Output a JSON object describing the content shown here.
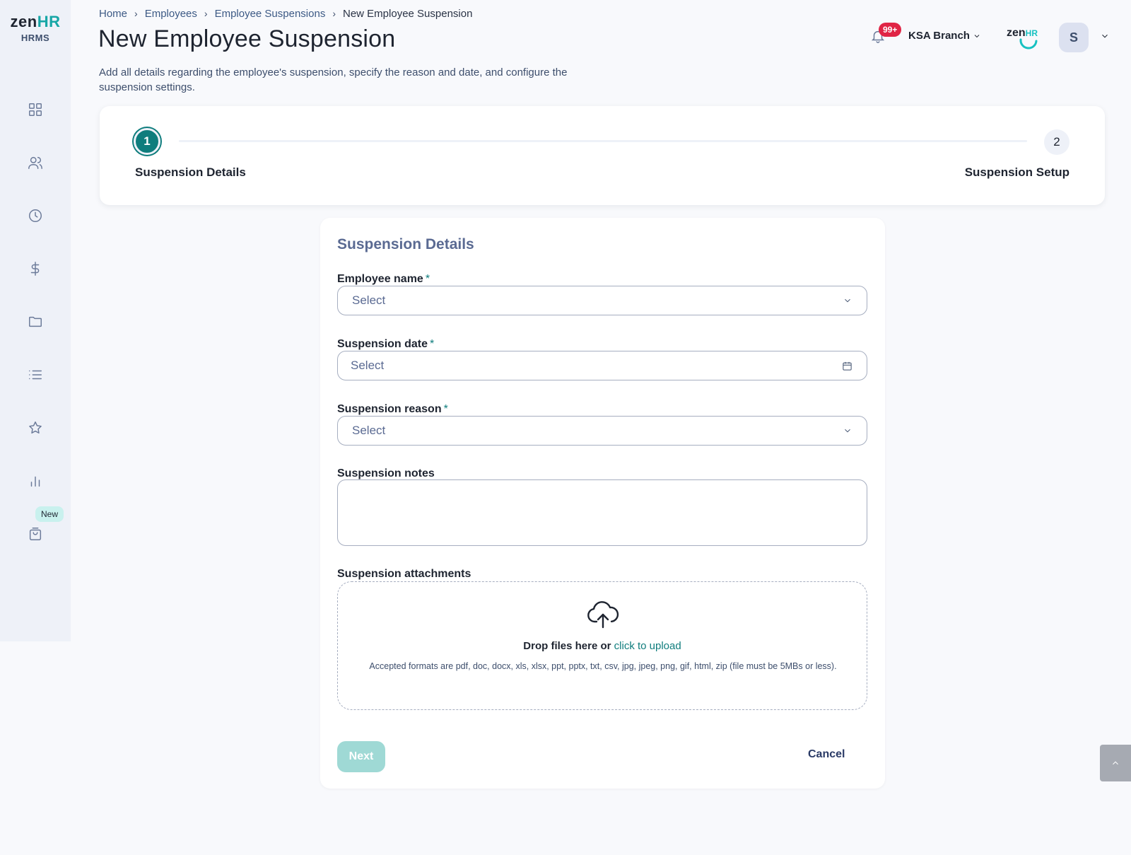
{
  "app": {
    "logo_prefix": "zen",
    "logo_suffix": "HR",
    "logo_sub": "HRMS"
  },
  "sidebar": {
    "items": [
      {
        "icon": "dashboard-icon"
      },
      {
        "icon": "users-icon"
      },
      {
        "icon": "clock-icon"
      },
      {
        "icon": "dollar-icon"
      },
      {
        "icon": "folder-icon"
      },
      {
        "icon": "list-icon"
      },
      {
        "icon": "star-icon"
      },
      {
        "icon": "bar-chart-icon"
      },
      {
        "icon": "shopping-bag-icon"
      }
    ],
    "new_badge": "New"
  },
  "breadcrumb": {
    "items": [
      "Home",
      "Employees",
      "Employee Suspensions"
    ],
    "current": "New Employee Suspension"
  },
  "header": {
    "title": "New Employee Suspension",
    "description": "Add all details regarding the employee's suspension, specify the reason and date, and configure the suspension settings.",
    "notification_count": "99+",
    "branch": "KSA Branch",
    "company_logo_prefix": "zen",
    "company_logo_suffix": "HR",
    "avatar_initial": "S"
  },
  "stepper": {
    "step1_number": "1",
    "step1_label": "Suspension Details",
    "step2_number": "2",
    "step2_label": "Suspension Setup"
  },
  "form": {
    "section_title": "Suspension Details",
    "employee_name_label": "Employee name",
    "employee_name_value": "Select",
    "suspension_date_label": "Suspension date",
    "suspension_date_value": "Select",
    "suspension_reason_label": "Suspension reason",
    "suspension_reason_value": "Select",
    "suspension_notes_label": "Suspension notes",
    "attachments_label": "Suspension attachments",
    "drop_text": "Drop files here or",
    "drop_link": "click to upload",
    "drop_hint": "Accepted formats are pdf, doc, docx, xls, xlsx, ppt, pptx, txt, csv, jpg, jpeg, png, gif, html, zip (file must be 5MBs or less).",
    "required_mark": "*",
    "next_label": "Next",
    "cancel_label": "Cancel"
  },
  "colors": {
    "accent": "#0f7d7d",
    "next_disabled": "#9fd9d5",
    "badge_red": "#e02545",
    "sidebar_bg": "#eef1f8"
  }
}
